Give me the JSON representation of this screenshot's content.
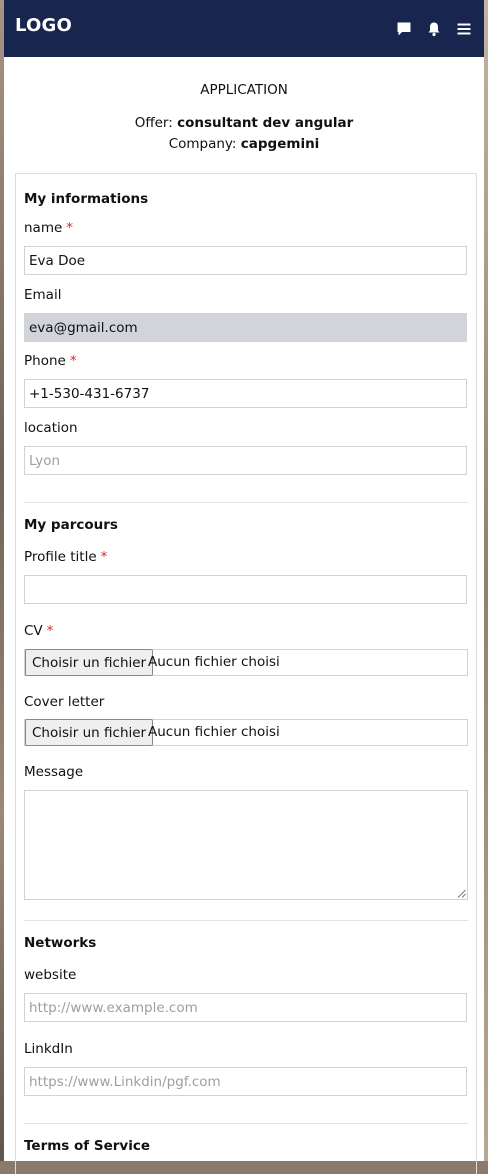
{
  "header": {
    "logo": "LOGO",
    "icons": [
      "chat-icon",
      "bell-icon",
      "menu-icon"
    ],
    "bg_color": "#17254f"
  },
  "application": {
    "title": "APPLICATION",
    "offer_label": "Offer:",
    "offer_value": "consultant dev angular",
    "company_label": "Company:",
    "company_value": "capgemini"
  },
  "form": {
    "required_mark": "*",
    "my_informations": {
      "title": "My informations",
      "name_label": "name",
      "name_value": "Eva Doe",
      "email_label": "Email",
      "email_value": "eva@gmail.com",
      "phone_label": "Phone",
      "phone_value": "+1-530-431-6737",
      "location_label": "location",
      "location_placeholder": "Lyon"
    },
    "my_parcours": {
      "title": "My parcours",
      "profile_title_label": "Profile title",
      "profile_title_value": "",
      "cv_label": "CV",
      "cover_letter_label": "Cover letter",
      "file_button_label": "Choisir un fichier",
      "file_status": "Aucun fichier choisi",
      "message_label": "Message"
    },
    "networks": {
      "title": "Networks",
      "website_label": "website",
      "website_placeholder": "http://www.example.com",
      "linkedin_label": "LinkdIn",
      "linkedin_placeholder": "https://www.Linkdin/pgf.com"
    },
    "terms": {
      "title": "Terms of Service"
    }
  },
  "colors": {
    "required": "#dc2626",
    "disabled_field": "#d1d5db"
  }
}
